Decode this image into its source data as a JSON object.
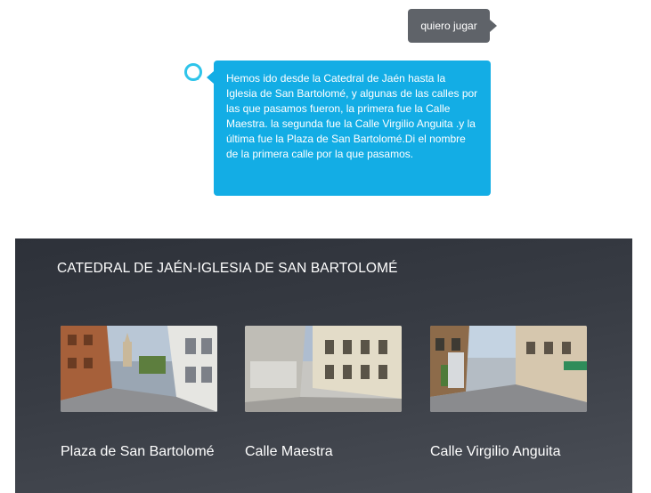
{
  "conversation": {
    "user_message": "quiero jugar",
    "assistant_message": "Hemos ido desde la Catedral de Jaén hasta la Iglesia de San Bartolomé, y algunas de las calles por las que pasamos fueron, la primera fue la Calle Maestra. la segunda fue la Calle Virgilio Anguita .y la última fue la Plaza de San Bartolomé.Di el nombre de la primera calle por la que pasamos."
  },
  "card": {
    "title": "CATEDRAL DE JAÉN-IGLESIA DE SAN BARTOLOMÉ",
    "items": [
      {
        "label": "Plaza de San Bartolomé",
        "image": "street-photo"
      },
      {
        "label": "Calle Maestra",
        "image": "street-photo"
      },
      {
        "label": "Calle Virgilio Anguita",
        "image": "street-photo"
      }
    ]
  },
  "colors": {
    "user_bubble": "#5f6369",
    "assistant_bubble": "#13ade5",
    "card_background": "#2d3139",
    "ring_icon": "#2ec4ea"
  },
  "icons": {
    "assistant_avatar": "alexa-ring-icon"
  }
}
